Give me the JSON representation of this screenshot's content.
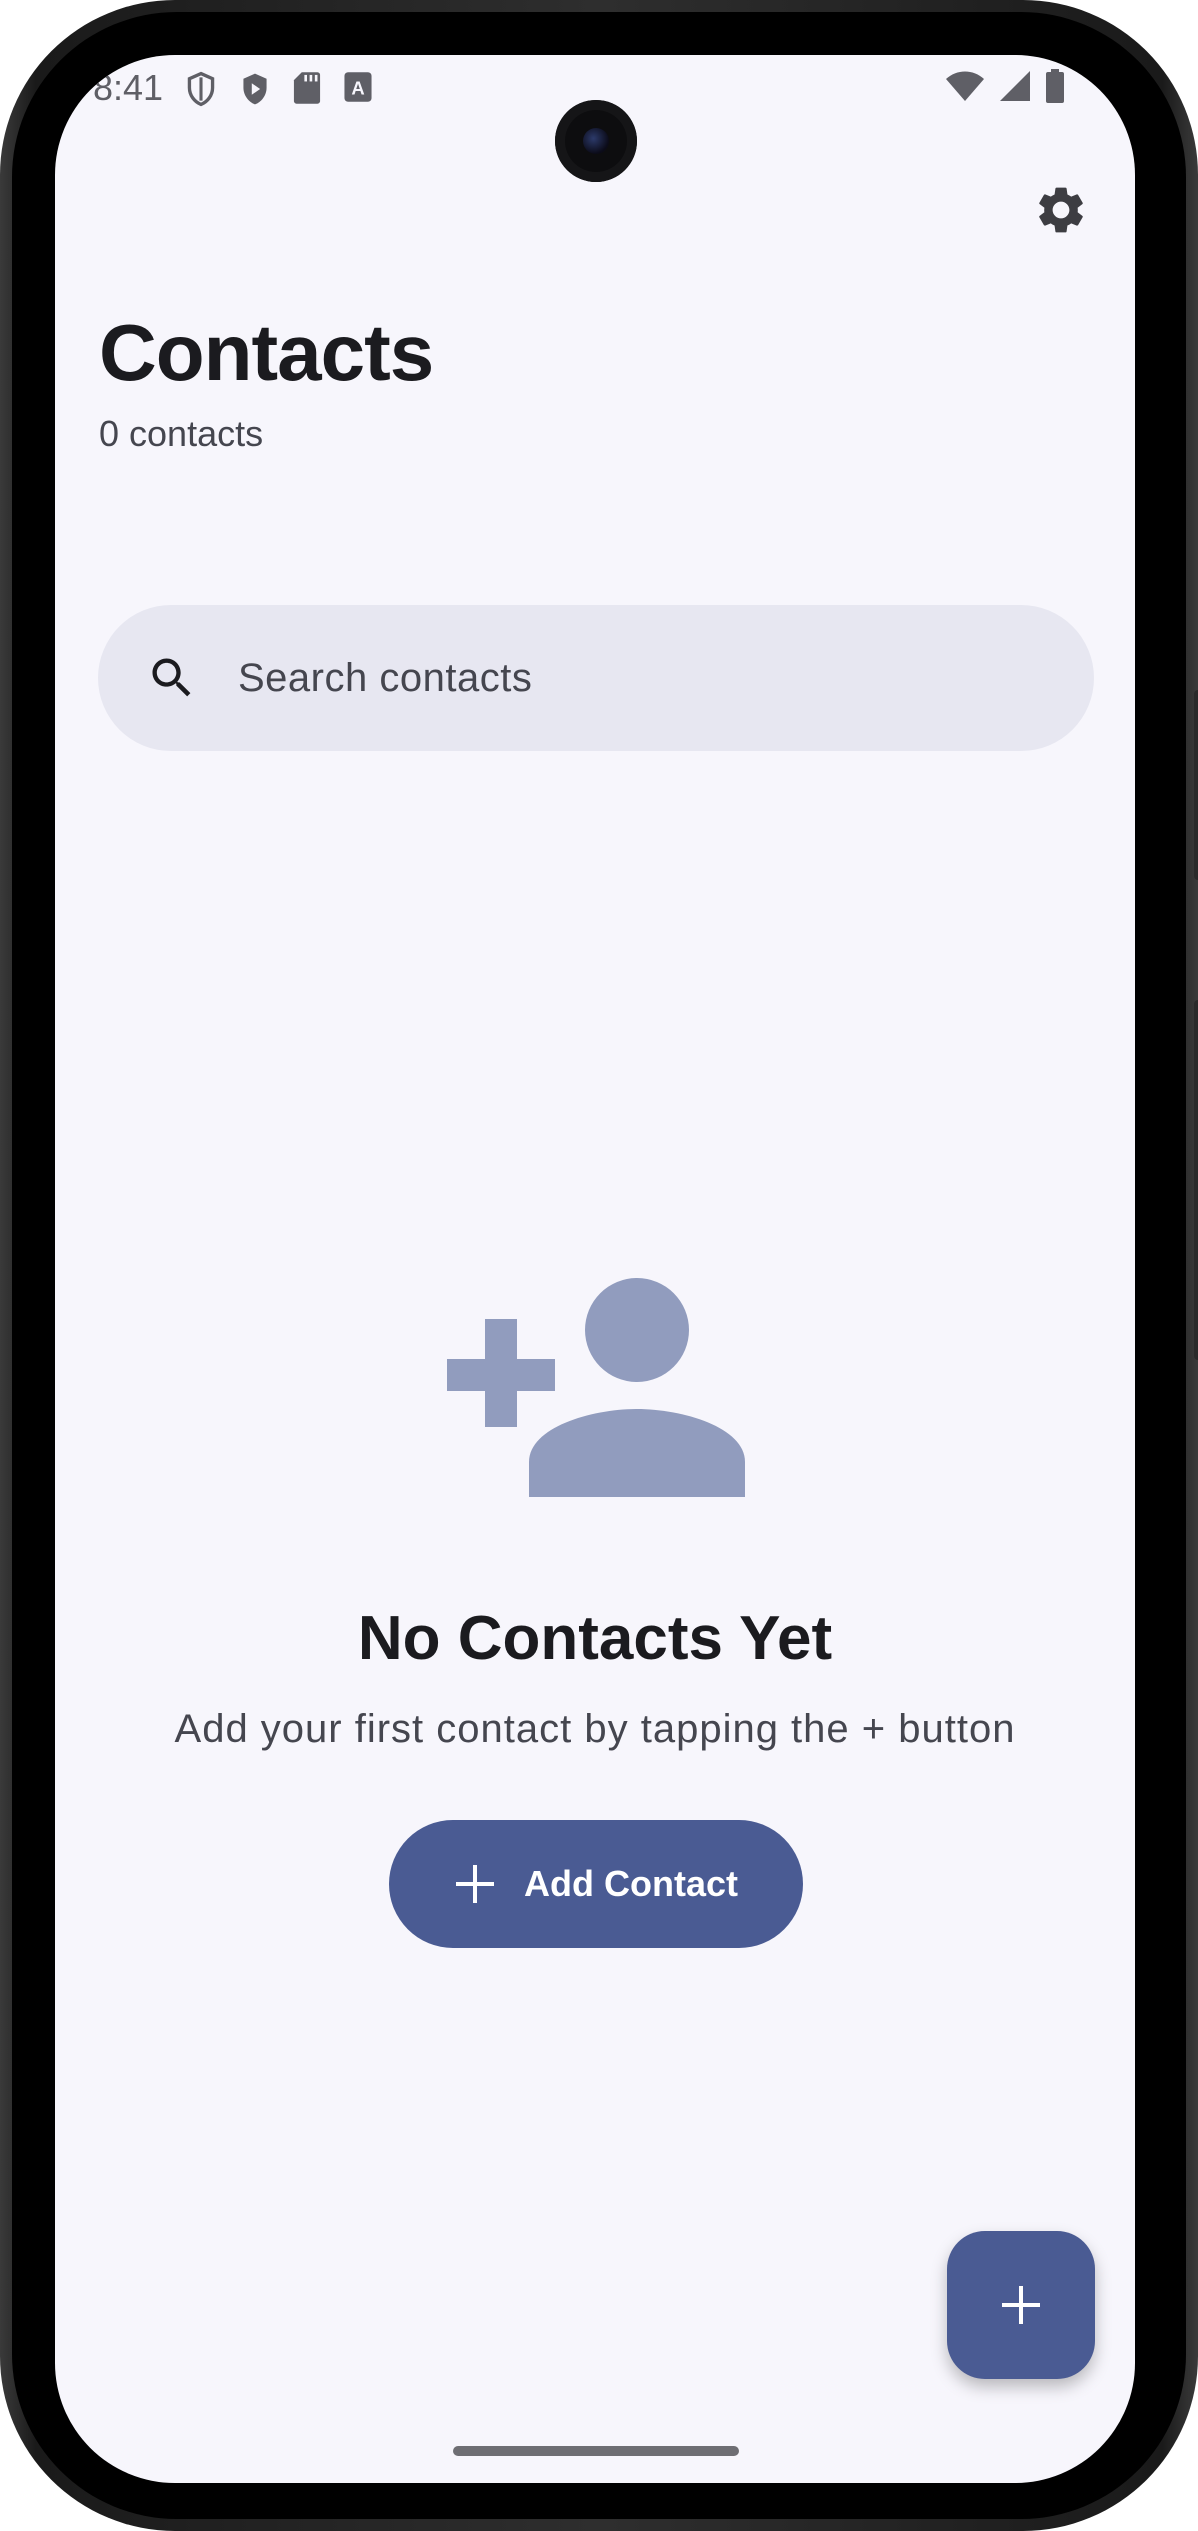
{
  "status_bar": {
    "time": "8:41",
    "left_icons": [
      "shield-outline-icon",
      "shield-play-icon",
      "sd-card-icon",
      "a-box-icon"
    ],
    "right_icons": [
      "wifi-icon",
      "cell-signal-icon",
      "battery-icon"
    ]
  },
  "header": {
    "title": "Contacts",
    "subtitle": "0 contacts",
    "settings_icon": "gear-icon"
  },
  "search": {
    "placeholder": "Search contacts",
    "icon": "search-icon"
  },
  "empty_state": {
    "icon": "person-add-icon",
    "icon_color": "#919cbe",
    "title": "No Contacts Yet",
    "description": "Add your first contact by tapping the + button",
    "button_label": "Add Contact",
    "button_icon": "plus-icon"
  },
  "fab": {
    "icon": "plus-icon"
  },
  "colors": {
    "accent": "#4a5b93",
    "background": "#f7f6fc",
    "search_background": "#e7e7f1",
    "text_primary": "#1b1b1f",
    "text_secondary": "#45464f"
  }
}
